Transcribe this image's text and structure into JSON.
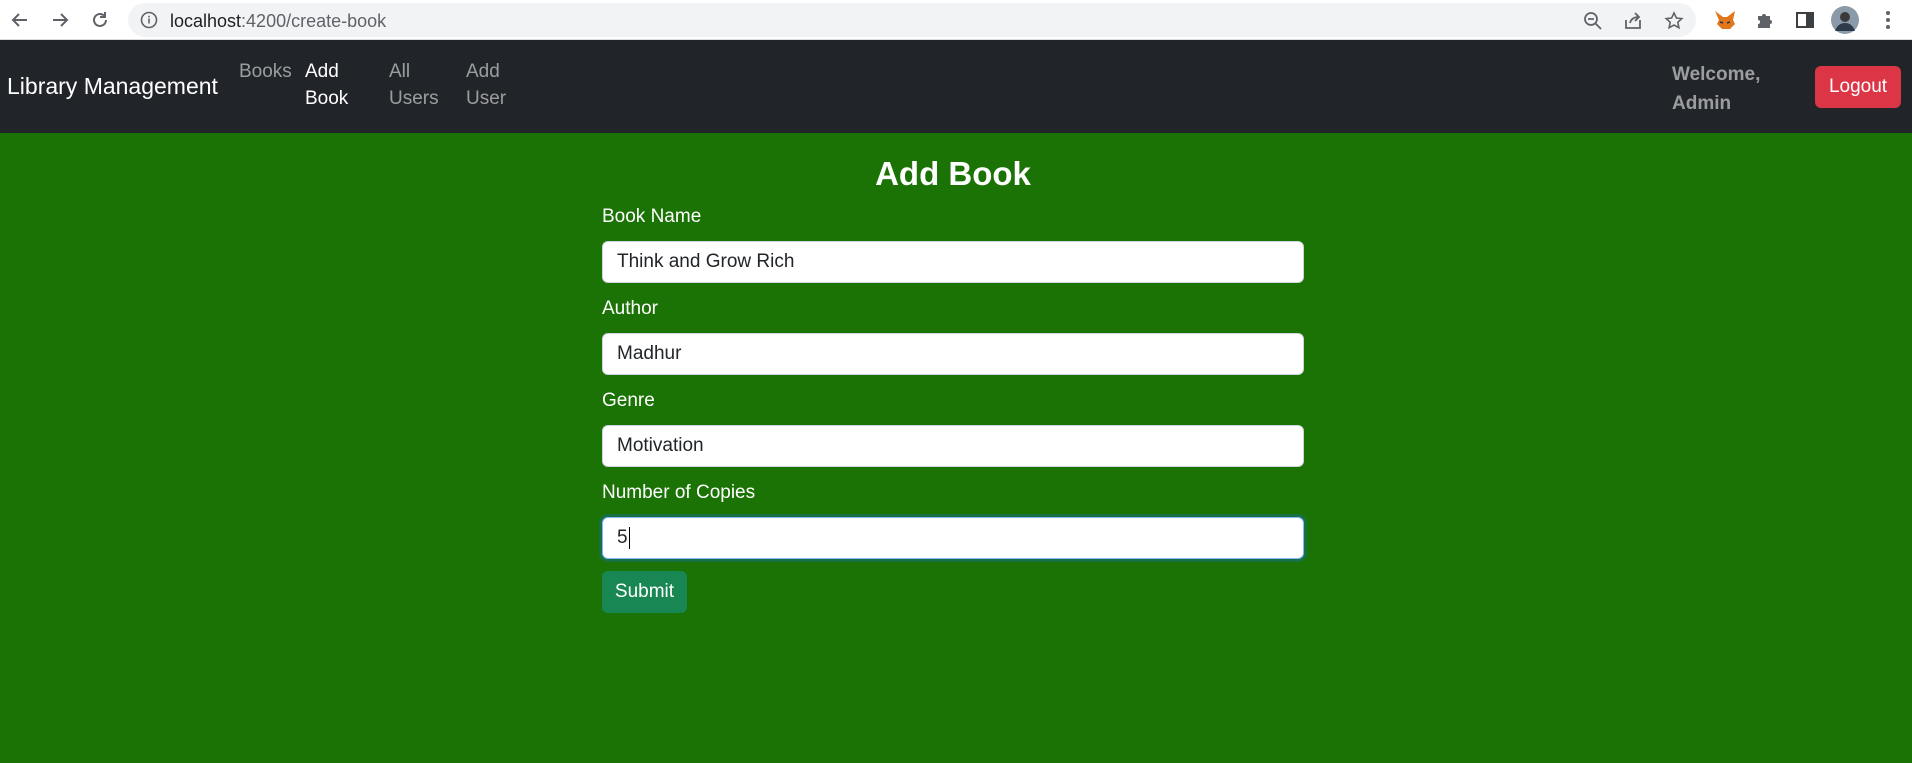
{
  "browser": {
    "url_host": "localhost",
    "url_path": ":4200/create-book"
  },
  "navbar": {
    "brand": "Library Management",
    "links": [
      {
        "line1": "Books",
        "line2": ""
      },
      {
        "line1": "Add",
        "line2": "Book"
      },
      {
        "line1": "All",
        "line2": "Users"
      },
      {
        "line1": "Add",
        "line2": "User"
      }
    ],
    "welcome_line1": "Welcome,",
    "welcome_line2": "Admin",
    "logout_label": "Logout"
  },
  "form": {
    "title": "Add Book",
    "fields": [
      {
        "label": "Book Name",
        "value": "Think and Grow Rich"
      },
      {
        "label": "Author",
        "value": "Madhur"
      },
      {
        "label": "Genre",
        "value": "Motivation"
      },
      {
        "label": "Number of Copies",
        "value": "5"
      }
    ],
    "submit_label": "Submit"
  },
  "colors": {
    "page_background": "#1b7205",
    "navbar_background": "#212529",
    "logout_button": "#dc3545",
    "submit_button": "#198754"
  }
}
